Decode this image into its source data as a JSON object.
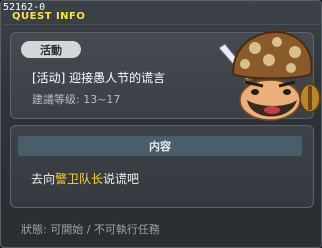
{
  "window": {
    "quest_id": "52162-0",
    "title": "QUEST INFO"
  },
  "quest": {
    "category_tag": "活動",
    "name": "[活动] 迎接愚人节的谎言",
    "recommended_level": "建議等级: 13~17",
    "npc_portrait": "mushroom-npc-portrait"
  },
  "content": {
    "header": "内容",
    "text_before": "去向",
    "npc_name": "警卫队长",
    "text_after": "说谎吧"
  },
  "status": {
    "text": "狀態: 可開始 / 不可執行任務"
  },
  "colors": {
    "title": "#ffe14a",
    "npc_link": "#ffd42a",
    "header_bar": "#4a5d6a"
  }
}
